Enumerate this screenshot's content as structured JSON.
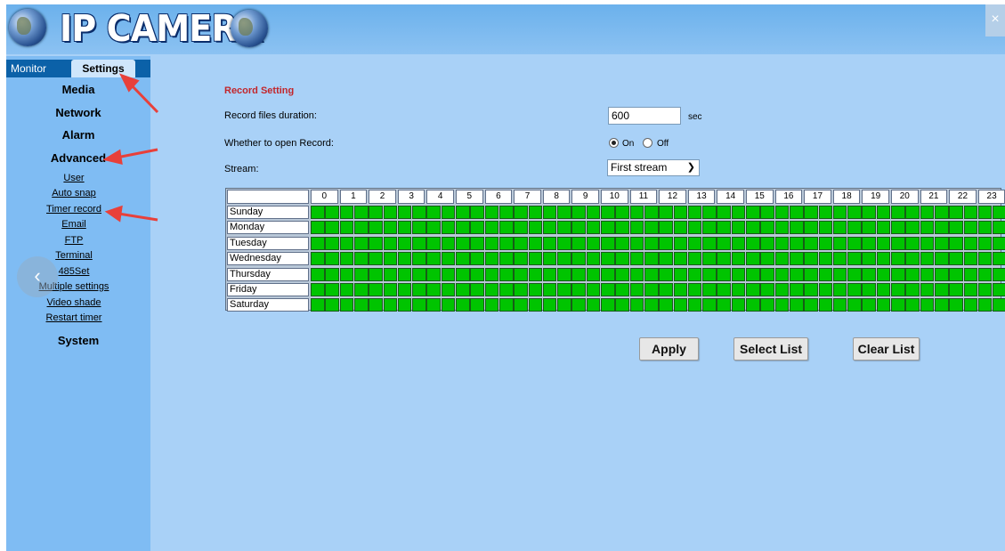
{
  "header": {
    "title": "IP CAMERA",
    "close_glyph": "×"
  },
  "tabs": {
    "monitor": "Monitor",
    "settings": "Settings"
  },
  "sidebar": {
    "media": "Media",
    "network": "Network",
    "alarm": "Alarm",
    "advanced": "Advanced",
    "links": [
      "User",
      "Auto snap",
      "Timer record",
      "Email",
      "FTP",
      "Terminal",
      "485Set",
      "Multiple settings",
      "Video shade",
      "Restart timer"
    ],
    "system": "System",
    "back_glyph": "‹"
  },
  "record": {
    "section_title": "Record Setting",
    "duration_label": "Record files duration:",
    "duration_value": "600",
    "duration_unit": "sec",
    "open_label": "Whether to open Record:",
    "on_label": "On",
    "off_label": "Off",
    "open_selected": "On",
    "stream_label": "Stream:",
    "stream_value": "First stream"
  },
  "schedule": {
    "hours": [
      "0",
      "1",
      "2",
      "3",
      "4",
      "5",
      "6",
      "7",
      "8",
      "9",
      "10",
      "11",
      "12",
      "13",
      "14",
      "15",
      "16",
      "17",
      "18",
      "19",
      "20",
      "21",
      "22",
      "23"
    ],
    "days": [
      "Sunday",
      "Monday",
      "Tuesday",
      "Wednesday",
      "Thursday",
      "Friday",
      "Saturday"
    ],
    "slots_per_hour": 2,
    "all_selected": true,
    "selected_color": "#00c400"
  },
  "buttons": {
    "apply": "Apply",
    "select_list": "Select List",
    "clear_list": "Clear List"
  },
  "colors": {
    "annotation_arrow": "#e8403a",
    "section_title": "#c2262b",
    "tab_bar": "#0b61a8"
  }
}
